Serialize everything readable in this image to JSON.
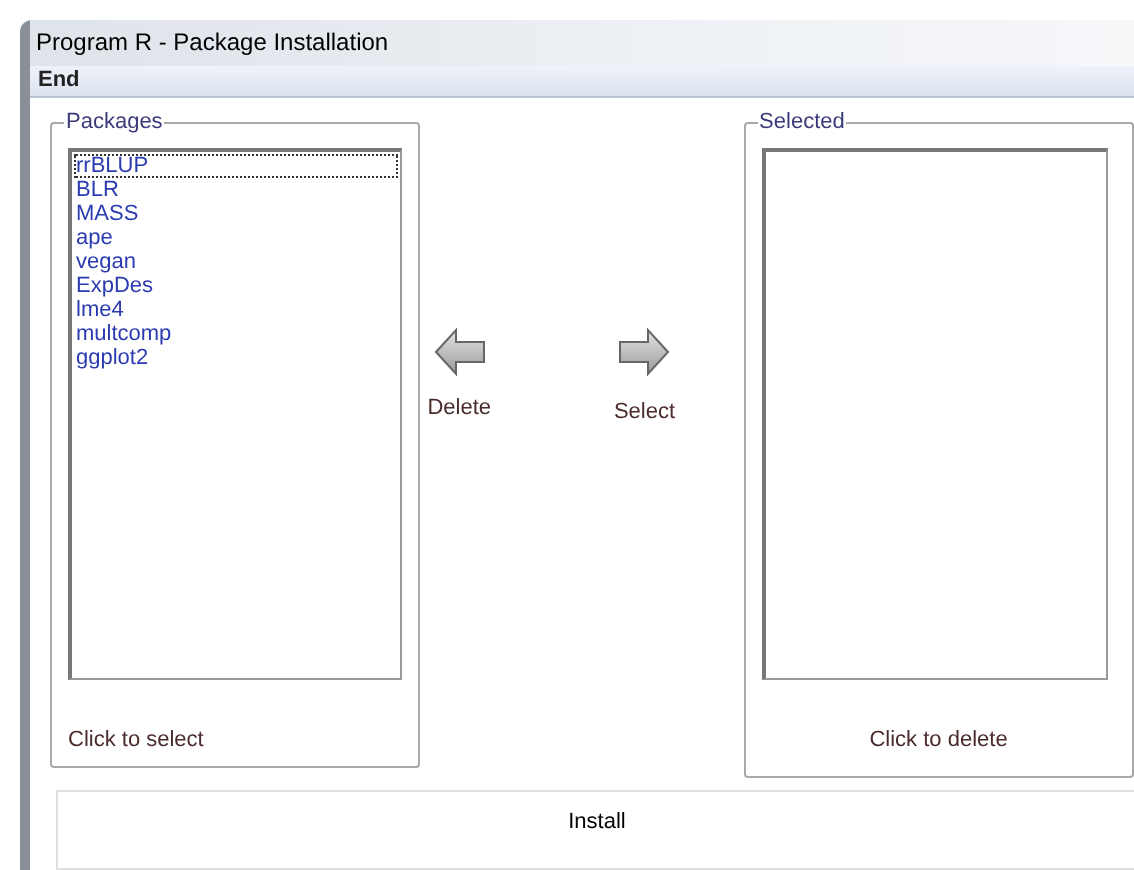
{
  "window": {
    "title": "Program R - Package Installation"
  },
  "menu": [
    {
      "label": "End"
    }
  ],
  "packages": {
    "legend": "Packages",
    "hint": "Click to select",
    "items": [
      {
        "label": "rrBLUP",
        "focused": true
      },
      {
        "label": "BLR",
        "focused": false
      },
      {
        "label": "MASS",
        "focused": false
      },
      {
        "label": "ape",
        "focused": false
      },
      {
        "label": "vegan",
        "focused": false
      },
      {
        "label": "ExpDes",
        "focused": false
      },
      {
        "label": "lme4",
        "focused": false
      },
      {
        "label": "multcomp",
        "focused": false
      },
      {
        "label": "ggplot2",
        "focused": false
      }
    ]
  },
  "actions": [
    {
      "kind": "left",
      "label": "Delete"
    },
    {
      "kind": "right",
      "label": "Select"
    }
  ],
  "selected": {
    "legend": "Selected",
    "hint": "Click to delete"
  },
  "install": {
    "label": "Install"
  }
}
